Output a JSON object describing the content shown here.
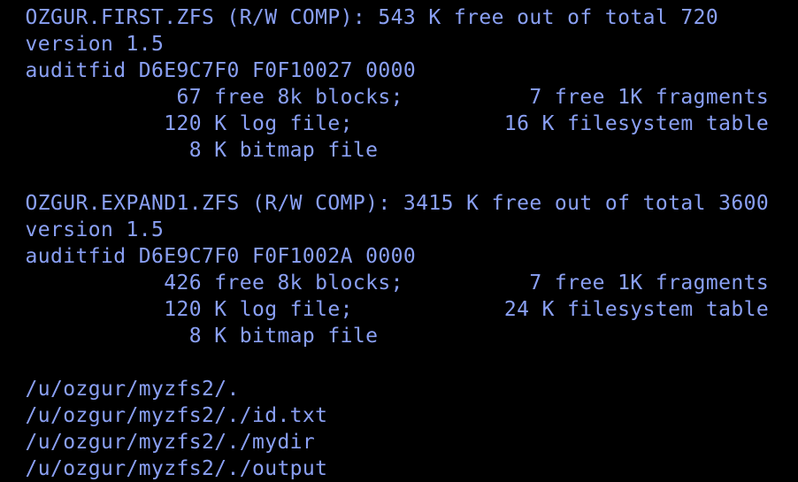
{
  "terminal": {
    "text_color": "#8aa0f4",
    "background_color": "#000000",
    "lines": [
      "  OZGUR.FIRST.ZFS (R/W COMP): 543 K free out of total 720",
      "  version 1.5",
      "  auditfid D6E9C7F0 F0F10027 0000",
      "              67 free 8k blocks;          7 free 1K fragments",
      "             120 K log file;            16 K filesystem table",
      "               8 K bitmap file",
      "",
      "  OZGUR.EXPAND1.ZFS (R/W COMP): 3415 K free out of total 3600",
      "  version 1.5",
      "  auditfid D6E9C7F0 F0F1002A 0000",
      "             426 free 8k blocks;          7 free 1K fragments",
      "             120 K log file;            24 K filesystem table",
      "               8 K bitmap file",
      "",
      "  /u/ozgur/myzfs2/.",
      "  /u/ozgur/myzfs2/./id.txt",
      "  /u/ozgur/myzfs2/./mydir",
      "  /u/ozgur/myzfs2/./output"
    ]
  }
}
